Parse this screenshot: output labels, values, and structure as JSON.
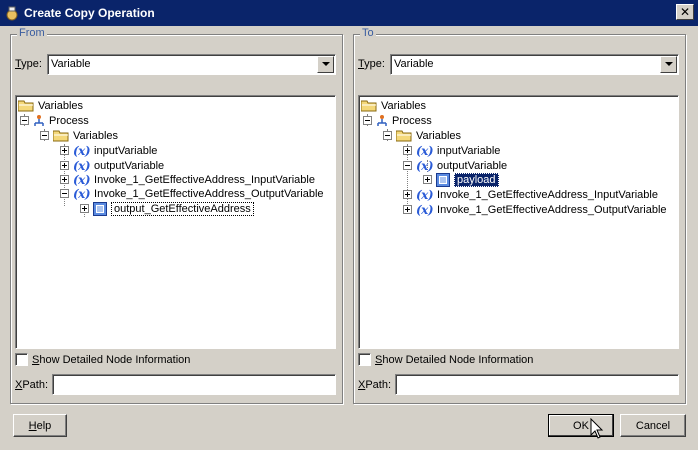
{
  "window": {
    "title": "Create Copy Operation"
  },
  "from": {
    "legend": "From",
    "type_label_u": "T",
    "type_label_rest": "ype:",
    "type_value": "Variable",
    "tree": {
      "root": "Variables",
      "process": "Process",
      "variables": "Variables",
      "items": [
        "inputVariable",
        "outputVariable",
        "Invoke_1_GetEffectiveAddress_InputVariable",
        "Invoke_1_GetEffectiveAddress_OutputVariable"
      ],
      "child": "output_GetEffectiveAddress"
    },
    "show_detailed_u": "S",
    "show_detailed_rest": "how Detailed Node Information",
    "xpath_u": "X",
    "xpath_rest": "Path:",
    "xpath_value": ""
  },
  "to": {
    "legend": "To",
    "type_label_u": "T",
    "type_label_rest": "ype:",
    "type_value": "Variable",
    "tree": {
      "root": "Variables",
      "process": "Process",
      "variables": "Variables",
      "items": [
        "inputVariable",
        "outputVariable",
        "Invoke_1_GetEffectiveAddress_InputVariable",
        "Invoke_1_GetEffectiveAddress_OutputVariable"
      ],
      "child": "payload"
    },
    "show_detailed_u": "S",
    "show_detailed_rest": "how Detailed Node Information",
    "xpath_u": "X",
    "xpath_rest": "Path:",
    "xpath_value": ""
  },
  "buttons": {
    "help_u": "H",
    "help_rest": "elp",
    "ok": "OK",
    "cancel": "Cancel"
  },
  "icons": {
    "folder": "folder-icon",
    "process": "process-icon",
    "variable": "x-variable-icon",
    "element": "element-icon"
  },
  "colors": {
    "titlebar": "#0a246a",
    "face": "#d4d0c8",
    "selection": "#0a246a",
    "legend": "#3a5da0",
    "variable": "#2a5bd7"
  }
}
